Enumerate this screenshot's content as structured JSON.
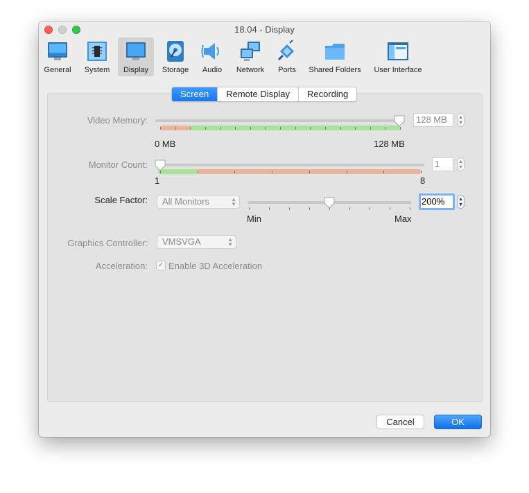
{
  "window": {
    "title": "18.04 - Display"
  },
  "toolbar": {
    "items": [
      {
        "label": "General",
        "icon": "general-monitor-icon"
      },
      {
        "label": "System",
        "icon": "chip-icon"
      },
      {
        "label": "Display",
        "icon": "display-monitor-icon",
        "active": true
      },
      {
        "label": "Storage",
        "icon": "disk-icon"
      },
      {
        "label": "Audio",
        "icon": "speaker-icon"
      },
      {
        "label": "Network",
        "icon": "network-icon"
      },
      {
        "label": "Ports",
        "icon": "port-plug-icon"
      },
      {
        "label": "Shared Folders",
        "icon": "folder-icon"
      },
      {
        "label": "User Interface",
        "icon": "ui-window-icon"
      }
    ]
  },
  "tabs": [
    {
      "label": "Screen",
      "selected": true
    },
    {
      "label": "Remote Display",
      "selected": false
    },
    {
      "label": "Recording",
      "selected": false
    }
  ],
  "video_memory": {
    "label": "Video Memory:",
    "value": "128 MB",
    "min_label": "0 MB",
    "max_label": "128 MB",
    "fraction": 1.0
  },
  "monitor_count": {
    "label": "Monitor Count:",
    "value": "1",
    "min_label": "1",
    "max_label": "8",
    "fraction": 0.0
  },
  "scale_factor": {
    "label": "Scale Factor:",
    "selector": "All Monitors",
    "value": "200%",
    "min_label": "Min",
    "max_label": "Max",
    "fraction": 0.5
  },
  "graphics_controller": {
    "label": "Graphics Controller:",
    "value": "VMSVGA"
  },
  "acceleration": {
    "label": "Acceleration:",
    "checkbox_label": "Enable 3D Acceleration",
    "checked": true
  },
  "buttons": {
    "cancel": "Cancel",
    "ok": "OK"
  },
  "colors": {
    "accent": "#1a77f0",
    "range_ok": "#a8e39a",
    "range_warn": "#e8b49c"
  }
}
